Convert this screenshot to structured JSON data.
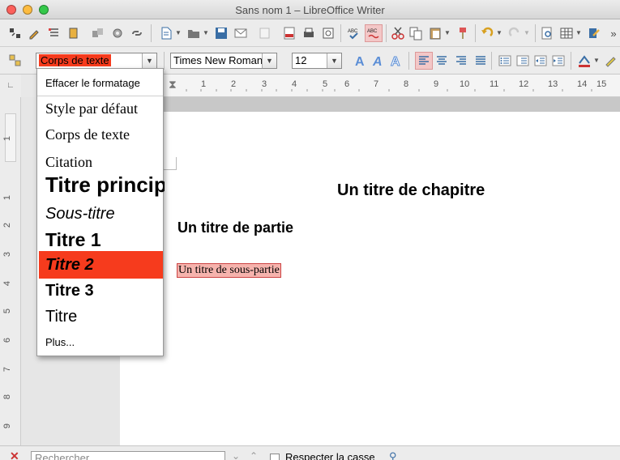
{
  "window": {
    "title": "Sans nom 1 – LibreOffice Writer"
  },
  "toolbar2": {
    "para_style": "Corps de texte",
    "font_name": "Times New Roman",
    "font_size": "12"
  },
  "ruler": {
    "h": [
      "1",
      "2",
      "3",
      "4",
      "5",
      "6",
      "7",
      "8",
      "9",
      "10",
      "11",
      "12",
      "13",
      "14",
      "15"
    ],
    "v": [
      "1",
      "1",
      "2",
      "3",
      "4",
      "5",
      "6",
      "7",
      "8",
      "9"
    ]
  },
  "style_menu": {
    "clear": "Effacer le formatage",
    "items": [
      "Style par défaut",
      "Corps de texte",
      "Citation",
      "Titre principal",
      "Sous-titre",
      "Titre 1",
      "Titre 2",
      "Titre 3",
      "Titre"
    ],
    "more": "Plus...",
    "selected": "Titre 2"
  },
  "document": {
    "chapter": "Un titre de chapitre",
    "part": "Un titre de partie",
    "subpart": "Un titre de sous-partie"
  },
  "findbar": {
    "search_placeholder": "Rechercher",
    "match_case": "Respecter la casse"
  },
  "colors": {
    "highlight": "#f63b1d",
    "close": "#ff5f57",
    "minimize": "#ffbd2e",
    "maximize": "#28c840"
  }
}
